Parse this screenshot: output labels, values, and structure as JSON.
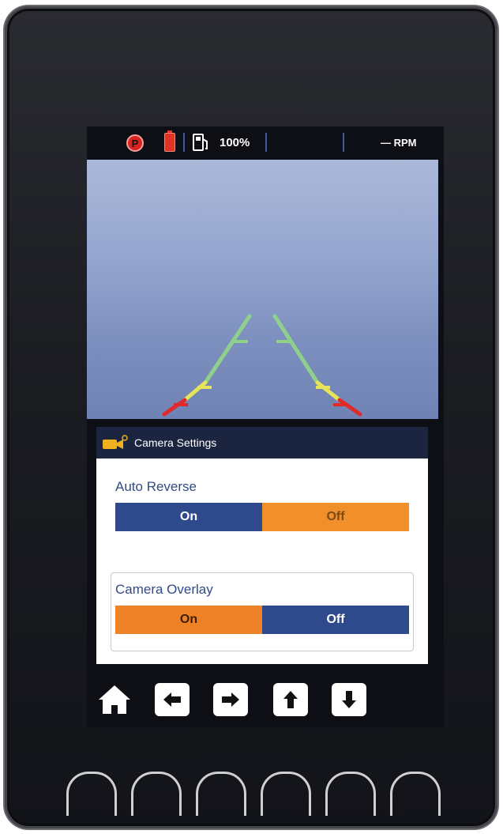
{
  "status_bar": {
    "park_icon": "parking-brake-icon",
    "park_letter": "P",
    "battery_icon": "battery-icon",
    "fuel_icon": "fuel-pump-icon",
    "fuel_level": "100%",
    "rpm_text": "— RPM"
  },
  "camera": {
    "guideline_colors": {
      "far": "#8fd18a",
      "mid": "#e6e45a",
      "near": "#e02a2a"
    }
  },
  "settings": {
    "header_icon": "camera-icon",
    "title": "Camera Settings",
    "auto_reverse": {
      "label": "Auto Reverse",
      "on_label": "On",
      "off_label": "Off",
      "selected": "Off"
    },
    "camera_overlay": {
      "label": "Camera Overlay",
      "on_label": "On",
      "off_label": "Off",
      "selected": "On"
    }
  },
  "nav": {
    "home_icon": "home-icon",
    "buttons": [
      "arrow-left-icon",
      "arrow-right-icon",
      "arrow-up-icon",
      "arrow-down-icon"
    ]
  },
  "colors": {
    "selected_orange": "#f1902b",
    "unselected_blue": "#2f4a8c",
    "warning_red": "#d8231f"
  }
}
